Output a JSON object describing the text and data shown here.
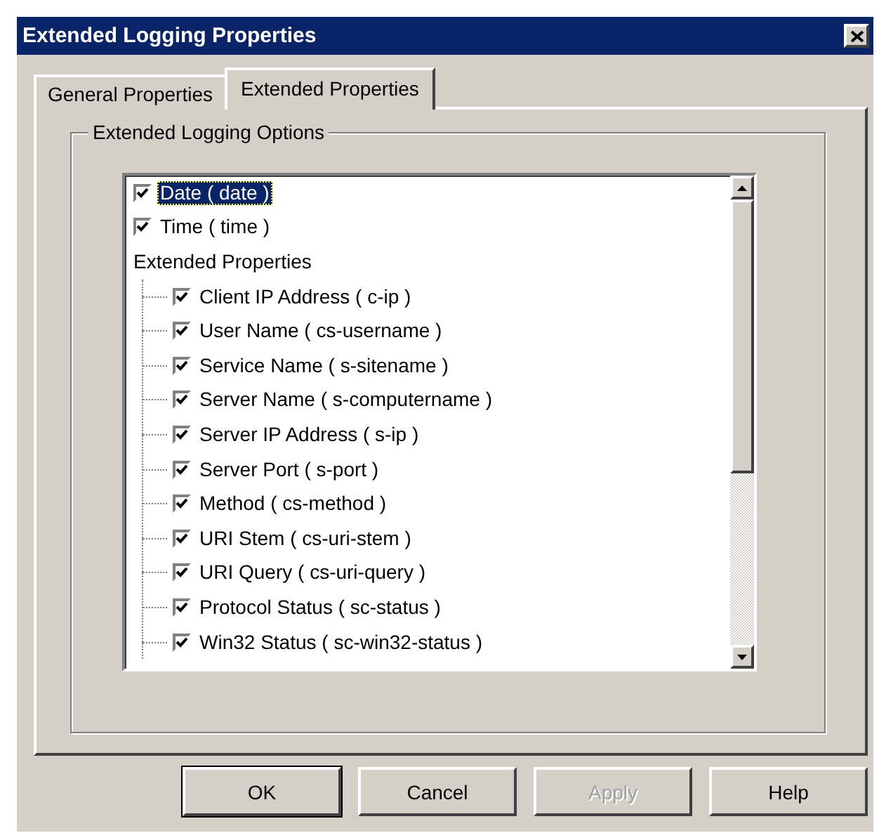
{
  "window": {
    "title": "Extended Logging Properties"
  },
  "tabs": [
    {
      "label": "General Properties",
      "selected": false
    },
    {
      "label": "Extended Properties",
      "selected": true
    }
  ],
  "group_box": {
    "label": "Extended Logging Options"
  },
  "options": [
    {
      "kind": "checkbox",
      "label": "Date ( date )",
      "checked": true,
      "selected": true
    },
    {
      "kind": "checkbox",
      "label": "Time ( time )",
      "checked": true,
      "selected": false
    },
    {
      "kind": "group",
      "label": "Extended Properties",
      "children": [
        {
          "label": "Client IP Address ( c-ip )",
          "checked": true,
          "selected": false
        },
        {
          "label": "User Name ( cs-username )",
          "checked": true,
          "selected": false
        },
        {
          "label": "Service Name ( s-sitename )",
          "checked": true,
          "selected": false
        },
        {
          "label": "Server Name ( s-computername )",
          "checked": true,
          "selected": false
        },
        {
          "label": "Server IP Address ( s-ip )",
          "checked": true,
          "selected": false
        },
        {
          "label": "Server Port ( s-port )",
          "checked": true,
          "selected": false
        },
        {
          "label": "Method ( cs-method )",
          "checked": true,
          "selected": false
        },
        {
          "label": "URI Stem ( cs-uri-stem )",
          "checked": true,
          "selected": false
        },
        {
          "label": "URI Query ( cs-uri-query )",
          "checked": true,
          "selected": false
        },
        {
          "label": "Protocol Status ( sc-status )",
          "checked": true,
          "selected": false
        },
        {
          "label": "Win32 Status ( sc-win32-status )",
          "checked": true,
          "selected": false
        }
      ]
    }
  ],
  "buttons": [
    {
      "label": "OK",
      "default": true,
      "disabled": false
    },
    {
      "label": "Cancel",
      "default": false,
      "disabled": false
    },
    {
      "label": "Apply",
      "default": false,
      "disabled": true
    },
    {
      "label": "Help",
      "default": false,
      "disabled": false
    }
  ]
}
